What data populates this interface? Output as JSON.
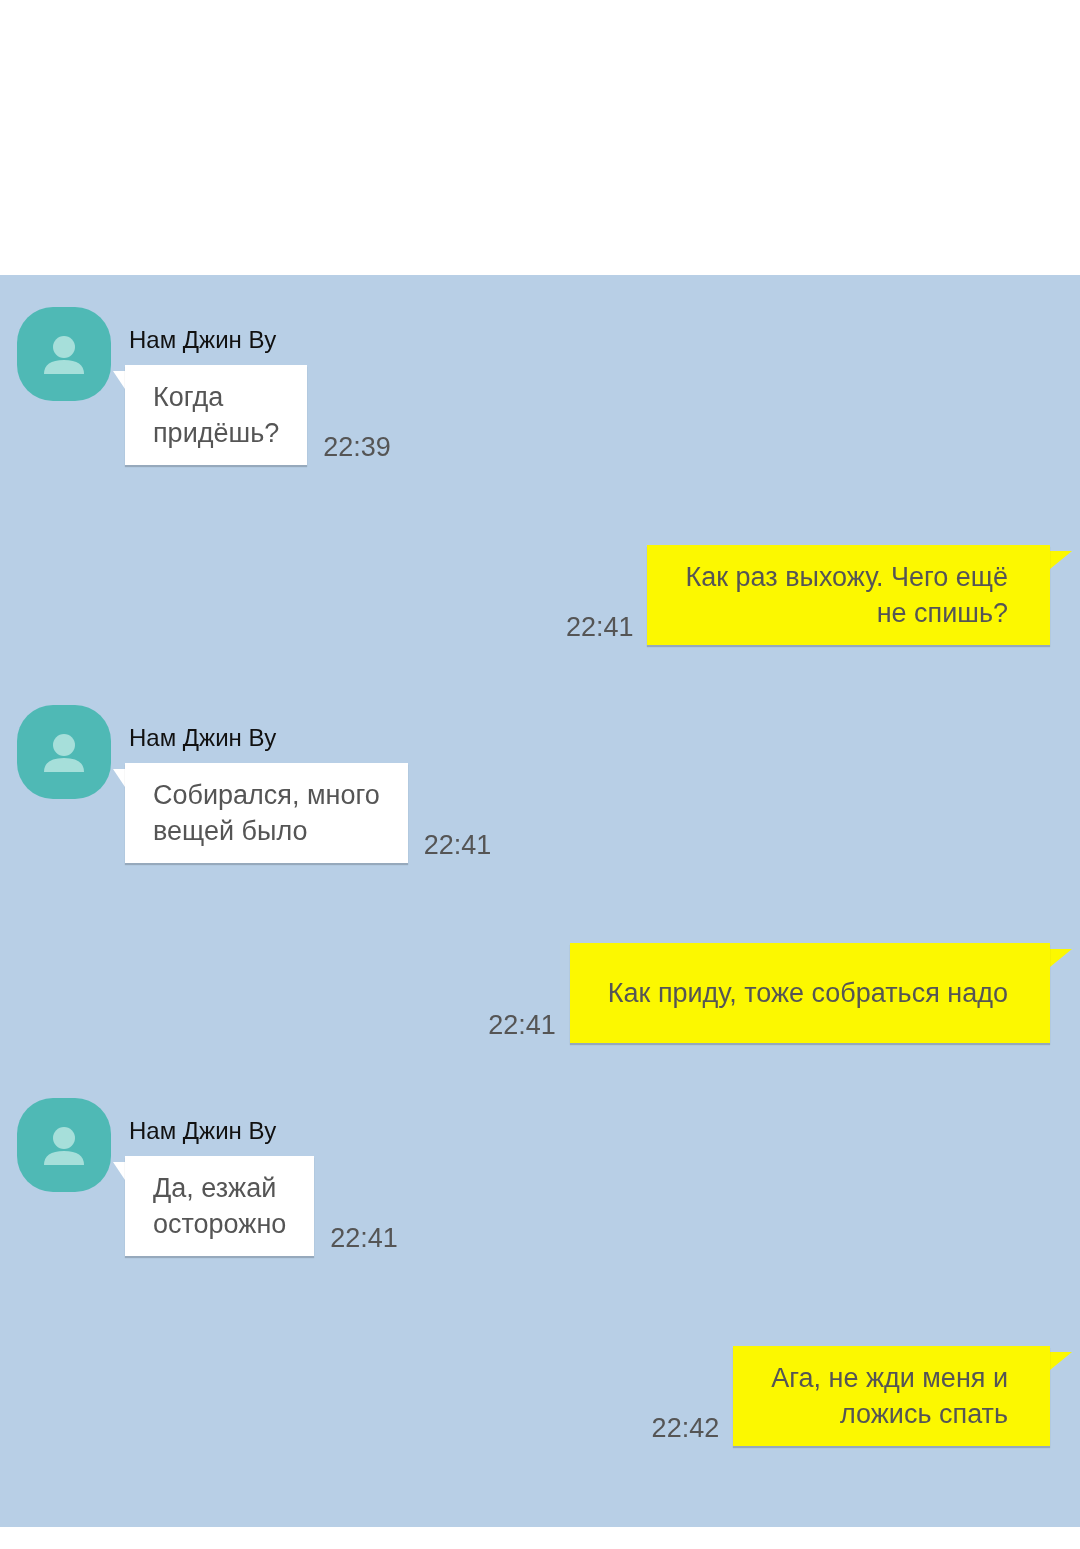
{
  "messages": [
    {
      "kind": "incoming",
      "sender": "Нам Джин Ву",
      "text": "Когда\nпридёшь?",
      "time": "22:39"
    },
    {
      "kind": "outgoing",
      "text": "Как раз выхожу. Чего ещё\nне спишь?",
      "time": "22:41"
    },
    {
      "kind": "incoming",
      "sender": "Нам Джин Ву",
      "text": "Собирался, много\nвещей было",
      "time": "22:41"
    },
    {
      "kind": "outgoing",
      "text": "Как приду, тоже собраться надо",
      "time": "22:41"
    },
    {
      "kind": "incoming",
      "sender": "Нам Джин Ву",
      "text": "Да, езжай\nосторожно",
      "time": "22:41"
    },
    {
      "kind": "outgoing",
      "text": "Ага, не жди меня и\nложись спать",
      "time": "22:42"
    }
  ]
}
